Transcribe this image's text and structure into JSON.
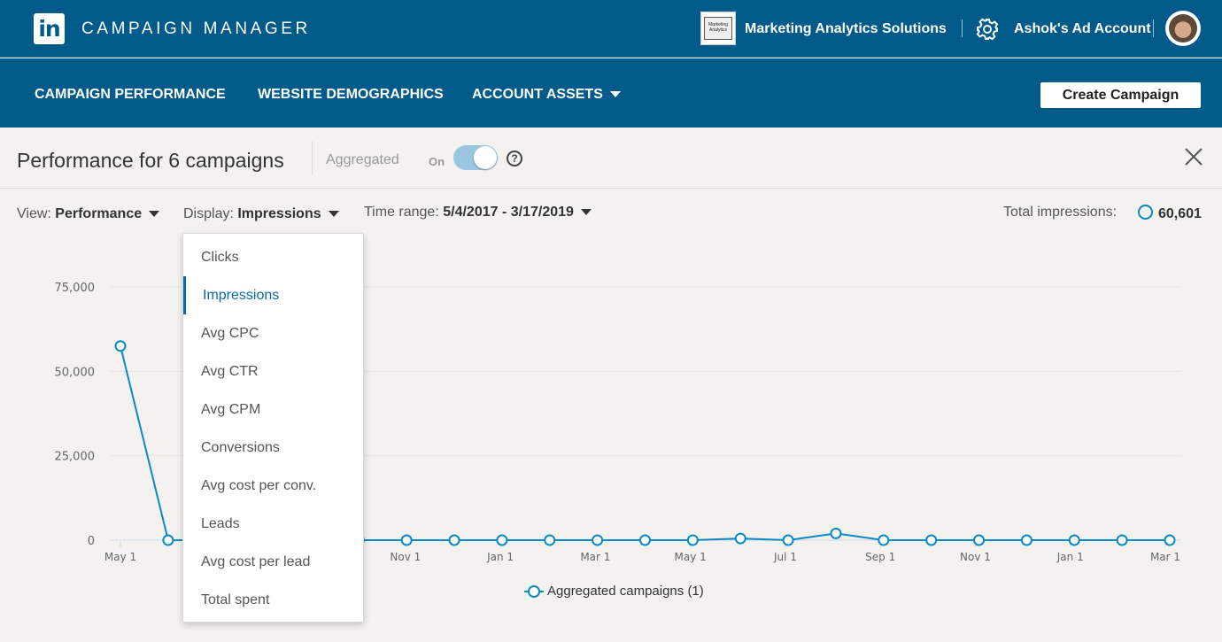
{
  "topbar": {
    "logo_text": "in",
    "app_title": "CAMPAIGN MANAGER",
    "org_logo_text": "Marketing Analytics",
    "org_name": "Marketing Analytics Solutions",
    "account_name": "Ashok's Ad Account",
    "icons": [
      "linkedin-logo",
      "gear-icon",
      "avatar"
    ]
  },
  "nav": {
    "items": [
      {
        "label": "CAMPAIGN PERFORMANCE"
      },
      {
        "label": "WEBSITE DEMOGRAPHICS"
      },
      {
        "label": "ACCOUNT ASSETS"
      }
    ],
    "create_button": "Create Campaign"
  },
  "perf": {
    "title": "Performance for 6 campaigns",
    "aggregated_label": "Aggregated",
    "toggle_state_label": "On",
    "toggle_on": true,
    "help_icon": "?"
  },
  "filters": {
    "view_label": "View:",
    "view_value": "Performance",
    "display_label": "Display:",
    "display_value": "Impressions",
    "time_label": "Time range:",
    "time_value": "5/4/2017 - 3/17/2019",
    "total_label": "Total impressions:",
    "total_value": "60,601"
  },
  "dropdown": {
    "selected": "Impressions",
    "items": [
      "Clicks",
      "Impressions",
      "Avg CPC",
      "Avg CTR",
      "Avg CPM",
      "Conversions",
      "Avg cost per conv.",
      "Leads",
      "Avg cost per lead",
      "Total spent"
    ]
  },
  "colors": {
    "header_bg": "#005a8a",
    "accent": "#0a89c4",
    "selected_item": "#0a6ba4"
  },
  "chart_data": {
    "type": "line",
    "ylim": [
      0,
      75000
    ],
    "yticks": [
      "75,000",
      "50,000",
      "25,000",
      "0"
    ],
    "ytick_values": [
      75000,
      50000,
      25000,
      0
    ],
    "xtick_labels": [
      "May 1",
      "Jul 1",
      "Sep 1",
      "Nov 1",
      "Jan 1",
      "Mar 1",
      "May 1",
      "Jul 1",
      "Sep 1",
      "Nov 1",
      "Jan 1",
      "Mar 1"
    ],
    "xtick_visible": [
      true,
      false,
      false,
      true,
      true,
      true,
      true,
      true,
      true,
      true,
      true,
      true
    ],
    "grid": true,
    "series": [
      {
        "name": "Aggregated campaigns (1)",
        "values": [
          57500,
          0,
          0,
          0,
          0,
          0,
          0,
          0,
          0,
          0,
          0,
          0,
          0,
          500,
          0,
          2000,
          0,
          0,
          0,
          0,
          0,
          0,
          0
        ]
      }
    ],
    "legend_position": "bottom-center"
  }
}
